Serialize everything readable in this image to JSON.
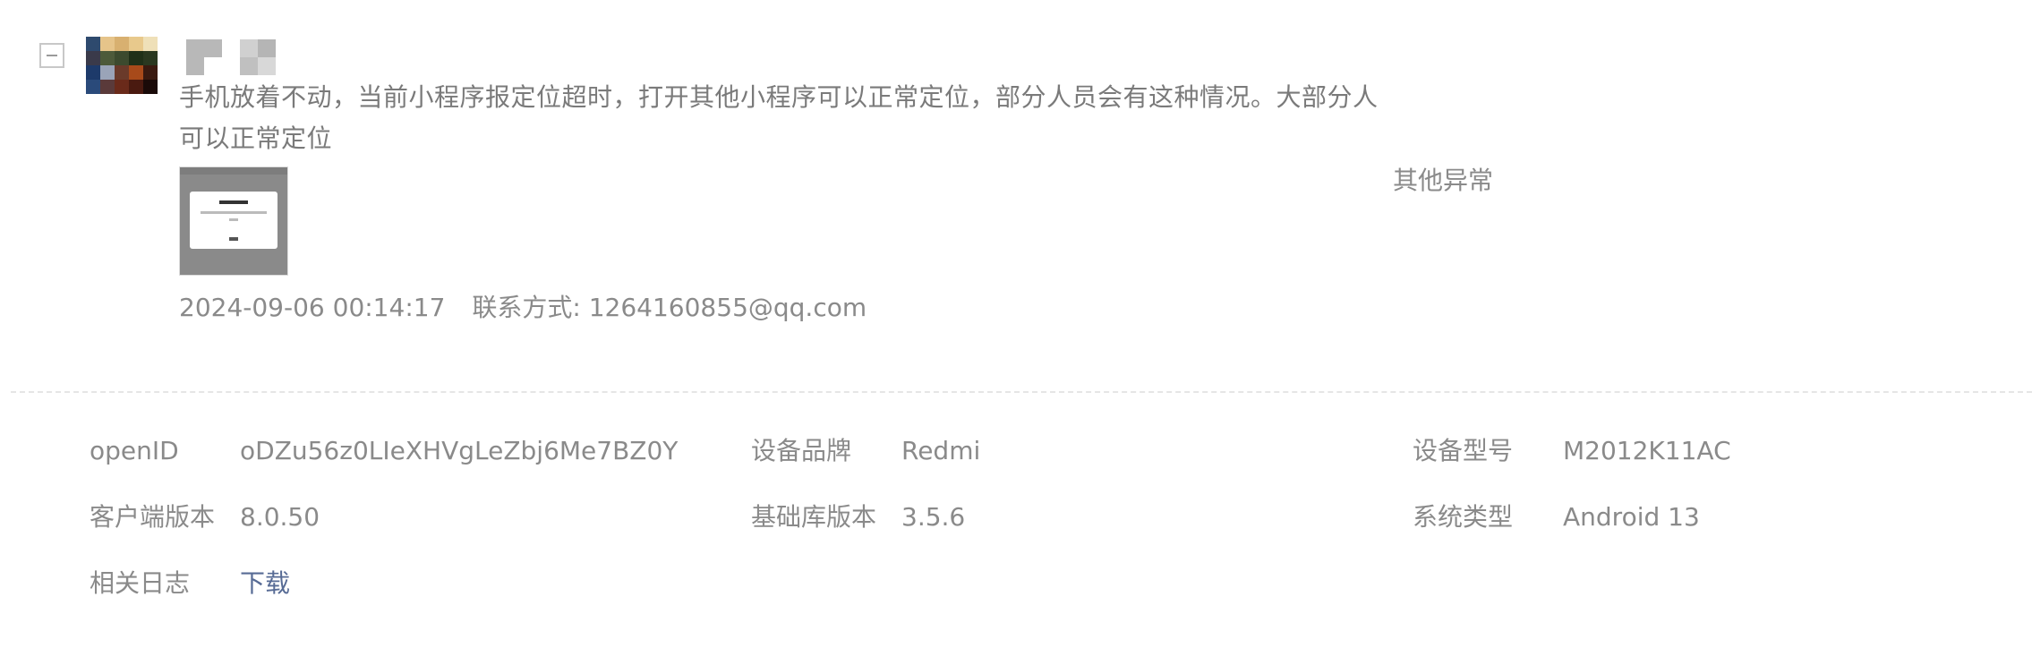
{
  "feedback": {
    "text": "手机放着不动，当前小程序报定位超时，打开其他小程序可以正常定位，部分人员会有这种情况。大部分人可以正常定位",
    "timestamp": "2024-09-06 00:14:17",
    "contact_label": "联系方式:",
    "contact_value": "1264160855@qq.com",
    "category": "其他异常",
    "avatar_icon": "blurred-user-avatar",
    "collapse_icon": "minus-square-icon"
  },
  "details": {
    "openid_label": "openID",
    "openid_value": "oDZu56z0LIeXHVgLeZbj6Me7BZ0Y",
    "brand_label": "设备品牌",
    "brand_value": "Redmi",
    "model_label": "设备型号",
    "model_value": "M2012K11AC",
    "client_label": "客户端版本",
    "client_value": "8.0.50",
    "sdk_label": "基础库版本",
    "sdk_value": "3.5.6",
    "os_label": "系统类型",
    "os_value": "Android 13",
    "log_label": "相关日志",
    "log_link": "下载"
  },
  "colors": {
    "link": "#576b95",
    "text_muted": "#8a8a8a"
  }
}
